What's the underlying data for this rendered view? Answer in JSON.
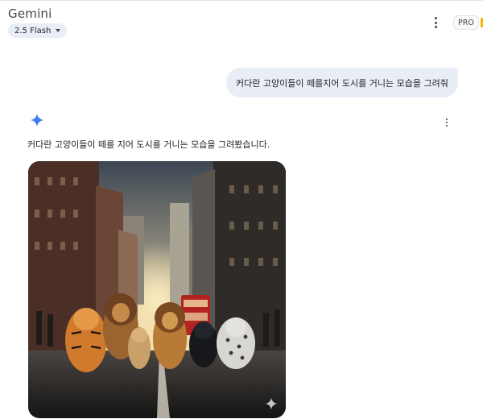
{
  "header": {
    "app_title": "Gemini",
    "model_label": "2.5 Flash",
    "pro_badge": "PRO"
  },
  "conversation": {
    "user_prompt": "커다란 고양이들이 떼를지어 도시를 거니는 모습을 그려줘",
    "response_text": "커다란 고양이들이 떼를 지어 도시를 거니는 모습을 그려봤습니다."
  },
  "colors": {
    "bubble": "#e9eef6",
    "accent_blue": "#4285f4",
    "text": "#1f1f1f"
  },
  "icons": {
    "menu": "more-vert-icon",
    "assistant": "gemini-spark-icon",
    "dropdown": "caret-down-icon"
  }
}
